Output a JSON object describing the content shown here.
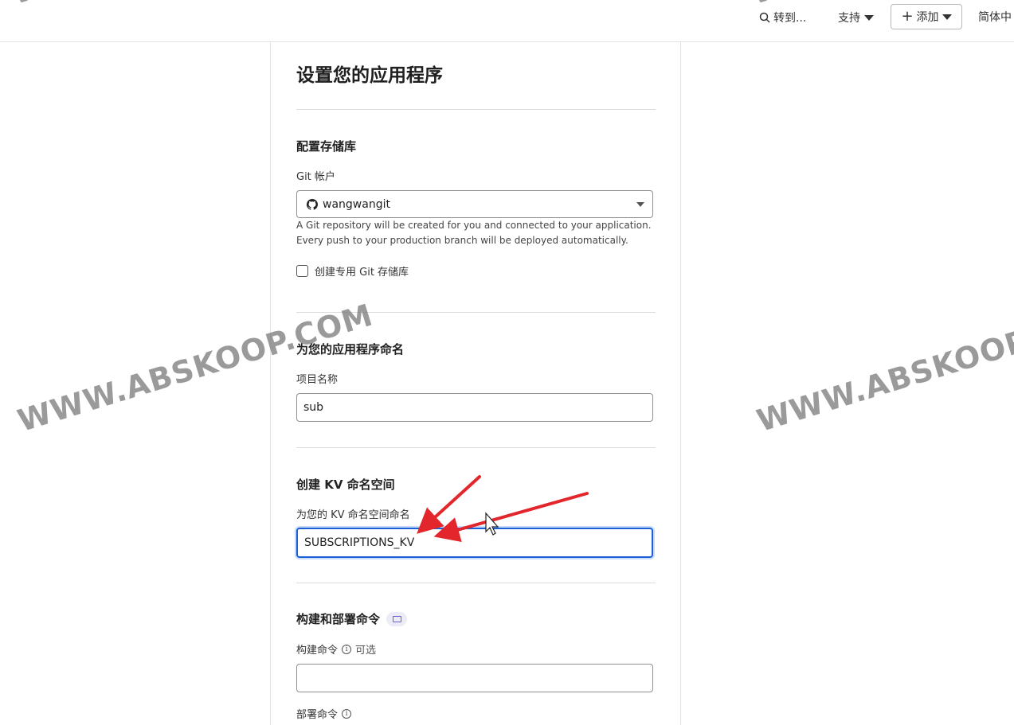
{
  "topbar": {
    "search_label": "转到...",
    "support_label": "支持",
    "add_label": "添加",
    "lang_label": "简体中"
  },
  "page": {
    "title": "设置您的应用程序"
  },
  "repo_section": {
    "title": "配置存储库",
    "account_label": "Git 帐户",
    "account_value": "wangwangit",
    "help_line1": "A Git repository will be created for you and connected to your application.",
    "help_line2": "Every push to your production branch will be deployed automatically.",
    "private_repo_label": "创建专用 Git 存储库",
    "private_repo_checked": false
  },
  "name_section": {
    "title": "为您的应用程序命名",
    "project_name_label": "项目名称",
    "project_name_value": "sub"
  },
  "kv_section": {
    "title": "创建 KV 命名空间",
    "namespace_label": "为您的 KV 命名空间命名",
    "namespace_value": "SUBSCRIPTIONS_KV"
  },
  "build_section": {
    "title": "构建和部署命令",
    "build_command_label": "构建命令",
    "build_command_optional": "可选",
    "build_command_value": "",
    "deploy_command_label": "部署命令"
  },
  "watermarks": {
    "text_left_top": "WWW.",
    "text_right_top": "WWW.",
    "text_left": "WWW.ABSKOOP.COM",
    "text_right": "WWW.ABSKOOP.S"
  },
  "colors": {
    "focus_border": "#1d5fd6",
    "annotation_arrow": "#e3262b",
    "badge_icon": "#6c5dd3"
  }
}
